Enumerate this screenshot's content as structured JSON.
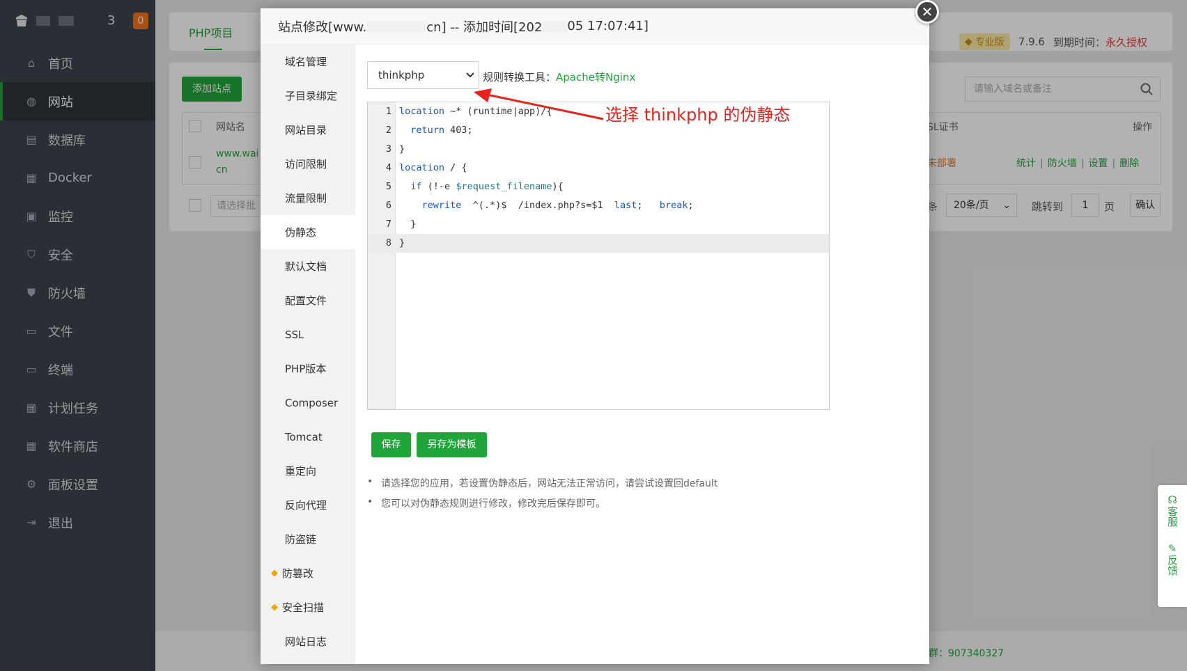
{
  "sidebar": {
    "header_count": "3",
    "header_badge": "0",
    "items": [
      {
        "label": "首页",
        "icon": "home-icon"
      },
      {
        "label": "网站",
        "icon": "globe-icon"
      },
      {
        "label": "数据库",
        "icon": "database-icon"
      },
      {
        "label": "Docker",
        "icon": "docker-icon"
      },
      {
        "label": "监控",
        "icon": "monitor-icon"
      },
      {
        "label": "安全",
        "icon": "shield-check-icon"
      },
      {
        "label": "防火墙",
        "icon": "firewall-icon"
      },
      {
        "label": "文件",
        "icon": "folder-icon"
      },
      {
        "label": "终端",
        "icon": "terminal-icon"
      },
      {
        "label": "计划任务",
        "icon": "calendar-icon"
      },
      {
        "label": "软件商店",
        "icon": "apps-icon"
      },
      {
        "label": "面板设置",
        "icon": "gear-icon"
      },
      {
        "label": "退出",
        "icon": "logout-icon"
      }
    ]
  },
  "background": {
    "tab_label": "PHP项目",
    "pro_label": "专业版",
    "version": "7.9.6",
    "expire_label": "到期时间：",
    "expire_value": "永久授权",
    "add_site_button": "添加站点",
    "search_placeholder": "请输入域名或备注",
    "col_site_name": "网站名",
    "col_ssl": "SL证书",
    "col_actions": "操作",
    "row_site": "www.wai",
    "row_site_suffix": "cn",
    "row_ssl": "未部署",
    "row_actions": [
      "统计",
      "防火墙",
      "设置",
      "删除"
    ],
    "bulk_placeholder": "请选择批",
    "page_size": "20条/页",
    "jump_label": "跳转到",
    "page_num": "1",
    "page_unit": "页",
    "confirm": "确认",
    "page_prefix": "条",
    "footer_text": "群：907340327"
  },
  "float_tools": {
    "service": "客服",
    "feedback": "反馈"
  },
  "modal": {
    "title_prefix": "站点修改[www.",
    "title_mid": "cn] -- 添加时间[202",
    "title_suffix": "05 17:07:41]",
    "tabs": [
      "域名管理",
      "子目录绑定",
      "网站目录",
      "访问限制",
      "流量限制",
      "伪静态",
      "默认文档",
      "配置文件",
      "SSL",
      "PHP版本",
      "Composer",
      "Tomcat",
      "重定向",
      "反向代理",
      "防盗链",
      "防篡改",
      "安全扫描",
      "网站日志"
    ],
    "active_tab": "伪静态",
    "rewrite_select": "thinkphp",
    "tool_label": "规则转换工具：",
    "tool_link": "Apache转Nginx",
    "code_lines": [
      "location ~* (runtime|app)/{",
      "  return 403;",
      "}",
      "location / {",
      "  if (!-e $request_filename){",
      "    rewrite  ^(.*)$  /index.php?s=$1  last;   break;",
      "  }",
      "}"
    ],
    "save_button": "保存",
    "save_template_button": "另存为模板",
    "tips": [
      "请选择您的应用，若设置伪静态后，网站无法正常访问，请尝试设置回default",
      "您可以对伪静态规则进行修改，修改完后保存即可。"
    ]
  },
  "annotation": {
    "text": "选择 thinkphp 的伪静态",
    "color": "#e8231e"
  },
  "colors": {
    "accent": "#20a53a",
    "sidebar_bg": "#3c444d",
    "badge": "#f0761e"
  }
}
